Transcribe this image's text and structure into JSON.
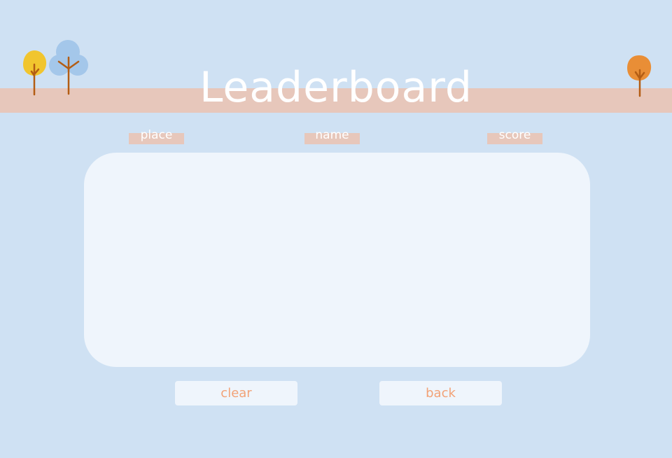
{
  "header": {
    "title": "Leaderboard"
  },
  "columns": {
    "place": "place",
    "name": "name",
    "score": "score"
  },
  "leaderboard": {
    "entries": []
  },
  "buttons": {
    "clear": "clear",
    "back": "back"
  },
  "colors": {
    "background": "#cfe1f3",
    "banner": "#e7c7bb",
    "panel": "#eff5fc",
    "button_text": "#f2a277",
    "tree_yellow": "#f1c52e",
    "tree_blue": "#a4c7ea",
    "tree_orange": "#e98e36",
    "trunk": "#b35d14"
  },
  "decorations": [
    "yellow-tree-icon",
    "blue-tree-icon",
    "orange-tree-icon"
  ]
}
